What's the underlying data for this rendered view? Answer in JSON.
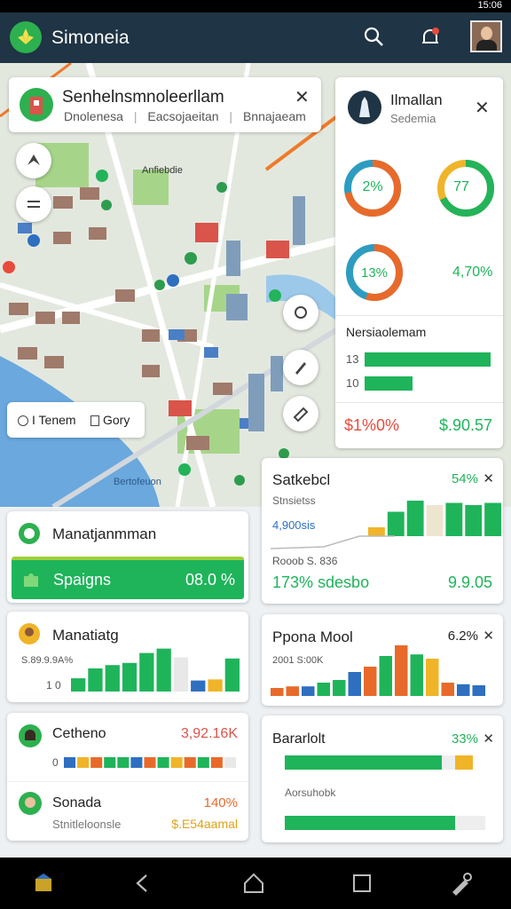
{
  "status_bar": {
    "time": "15:06"
  },
  "app": {
    "title": "Simoneia"
  },
  "map": {
    "label_small": "Anfiebdie",
    "label_bottom": "Bertofeuon",
    "toggle_left": "I Tenem",
    "toggle_right": "Gory"
  },
  "location_card": {
    "title": "Senhelnsmnoleerllam",
    "tags": [
      "Dnolenesa",
      "Eacsojaeitan",
      "Bnnajaeam"
    ]
  },
  "side_panel": {
    "title": "Ilmallan",
    "subtitle": "Sedemia",
    "ring1": {
      "label": "2%",
      "value": 0.72,
      "color": "#e86a2a"
    },
    "ring2": {
      "label": "77",
      "value": 0.68,
      "color": "#23b35a"
    },
    "ring3": {
      "label": "13%",
      "value": 0.55,
      "color": "#e86a2a"
    },
    "ring4_label": "4,70%",
    "section_title": "Nersiaolemam",
    "bars": [
      {
        "label": "13",
        "value": 0.95
      },
      {
        "label": "10",
        "value": 0.36
      }
    ],
    "stat_left": "$1%0%",
    "stat_right": "$.90.57"
  },
  "cards": {
    "c1": {
      "title": "Manatjanmman",
      "band_label": "Spaigns",
      "band_value": "08.0 %"
    },
    "c2": {
      "title": "Manatiatg",
      "sub": "S.89.9.9A%",
      "axis": "1 0",
      "bars": [
        {
          "v": 0.24,
          "c": "#1fb45a"
        },
        {
          "v": 0.42,
          "c": "#1fb45a"
        },
        {
          "v": 0.48,
          "c": "#1fb45a"
        },
        {
          "v": 0.52,
          "c": "#1fb45a"
        },
        {
          "v": 0.7,
          "c": "#1fb45a"
        },
        {
          "v": 0.78,
          "c": "#1fb45a"
        },
        {
          "v": 0.62,
          "c": "#e8e8e8"
        },
        {
          "v": 0.2,
          "c": "#2e6fc0"
        },
        {
          "v": 0.22,
          "c": "#f0b429"
        },
        {
          "v": 0.6,
          "c": "#1fb45a"
        }
      ]
    },
    "c3": {
      "title": "Cetheno",
      "value": "3,92.16K",
      "axis": "0",
      "segments": [
        "#2e6fc0",
        "#f0b429",
        "#e86a2a",
        "#1fb45a",
        "#1fb45a",
        "#2e6fc0",
        "#e86a2a",
        "#1fb45a",
        "#f0b429",
        "#e86a2a",
        "#1fb45a",
        "#e86a2a",
        "#e8e8e8"
      ]
    },
    "c4": {
      "title": "Sonada",
      "percent": "140%",
      "sub": "Stnitleloonsle",
      "value": "$.E54aamal"
    },
    "c5": {
      "title": "Satkebcl",
      "percent": "54%",
      "sub1": "Stnsietss",
      "sub2": "4,900sis",
      "axis": "Rooob S. 836",
      "stat_left": "173% sdesbo",
      "stat_right": "9.9.05",
      "bars": [
        {
          "v": 0.2,
          "c": "#f0b429"
        },
        {
          "v": 0.55,
          "c": "#1fb45a"
        },
        {
          "v": 0.8,
          "c": "#1fb45a"
        },
        {
          "v": 0.7,
          "c": "#eee5d0"
        },
        {
          "v": 0.75,
          "c": "#1fb45a"
        },
        {
          "v": 0.7,
          "c": "#1fb45a"
        },
        {
          "v": 0.75,
          "c": "#1fb45a"
        }
      ]
    },
    "c6": {
      "title": "Ppona Mool",
      "percent": "6.2%",
      "sub": "2001 S:00K",
      "bars": [
        {
          "v": 0.15,
          "c": "#e86a2a"
        },
        {
          "v": 0.18,
          "c": "#e86a2a"
        },
        {
          "v": 0.18,
          "c": "#2e6fc0"
        },
        {
          "v": 0.25,
          "c": "#1fb45a"
        },
        {
          "v": 0.3,
          "c": "#1fb45a"
        },
        {
          "v": 0.45,
          "c": "#2e6fc0"
        },
        {
          "v": 0.55,
          "c": "#e86a2a"
        },
        {
          "v": 0.75,
          "c": "#1fb45a"
        },
        {
          "v": 0.95,
          "c": "#e86a2a"
        },
        {
          "v": 0.78,
          "c": "#1fb45a"
        },
        {
          "v": 0.7,
          "c": "#f0b429"
        },
        {
          "v": 0.25,
          "c": "#e86a2a"
        },
        {
          "v": 0.22,
          "c": "#2e6fc0"
        },
        {
          "v": 0.2,
          "c": "#2e6fc0"
        }
      ]
    },
    "c7": {
      "title": "Bararlolt",
      "percent": "33%",
      "sub": "Aorsuhobk",
      "bar1": 0.92,
      "bar2": 0.85
    }
  }
}
